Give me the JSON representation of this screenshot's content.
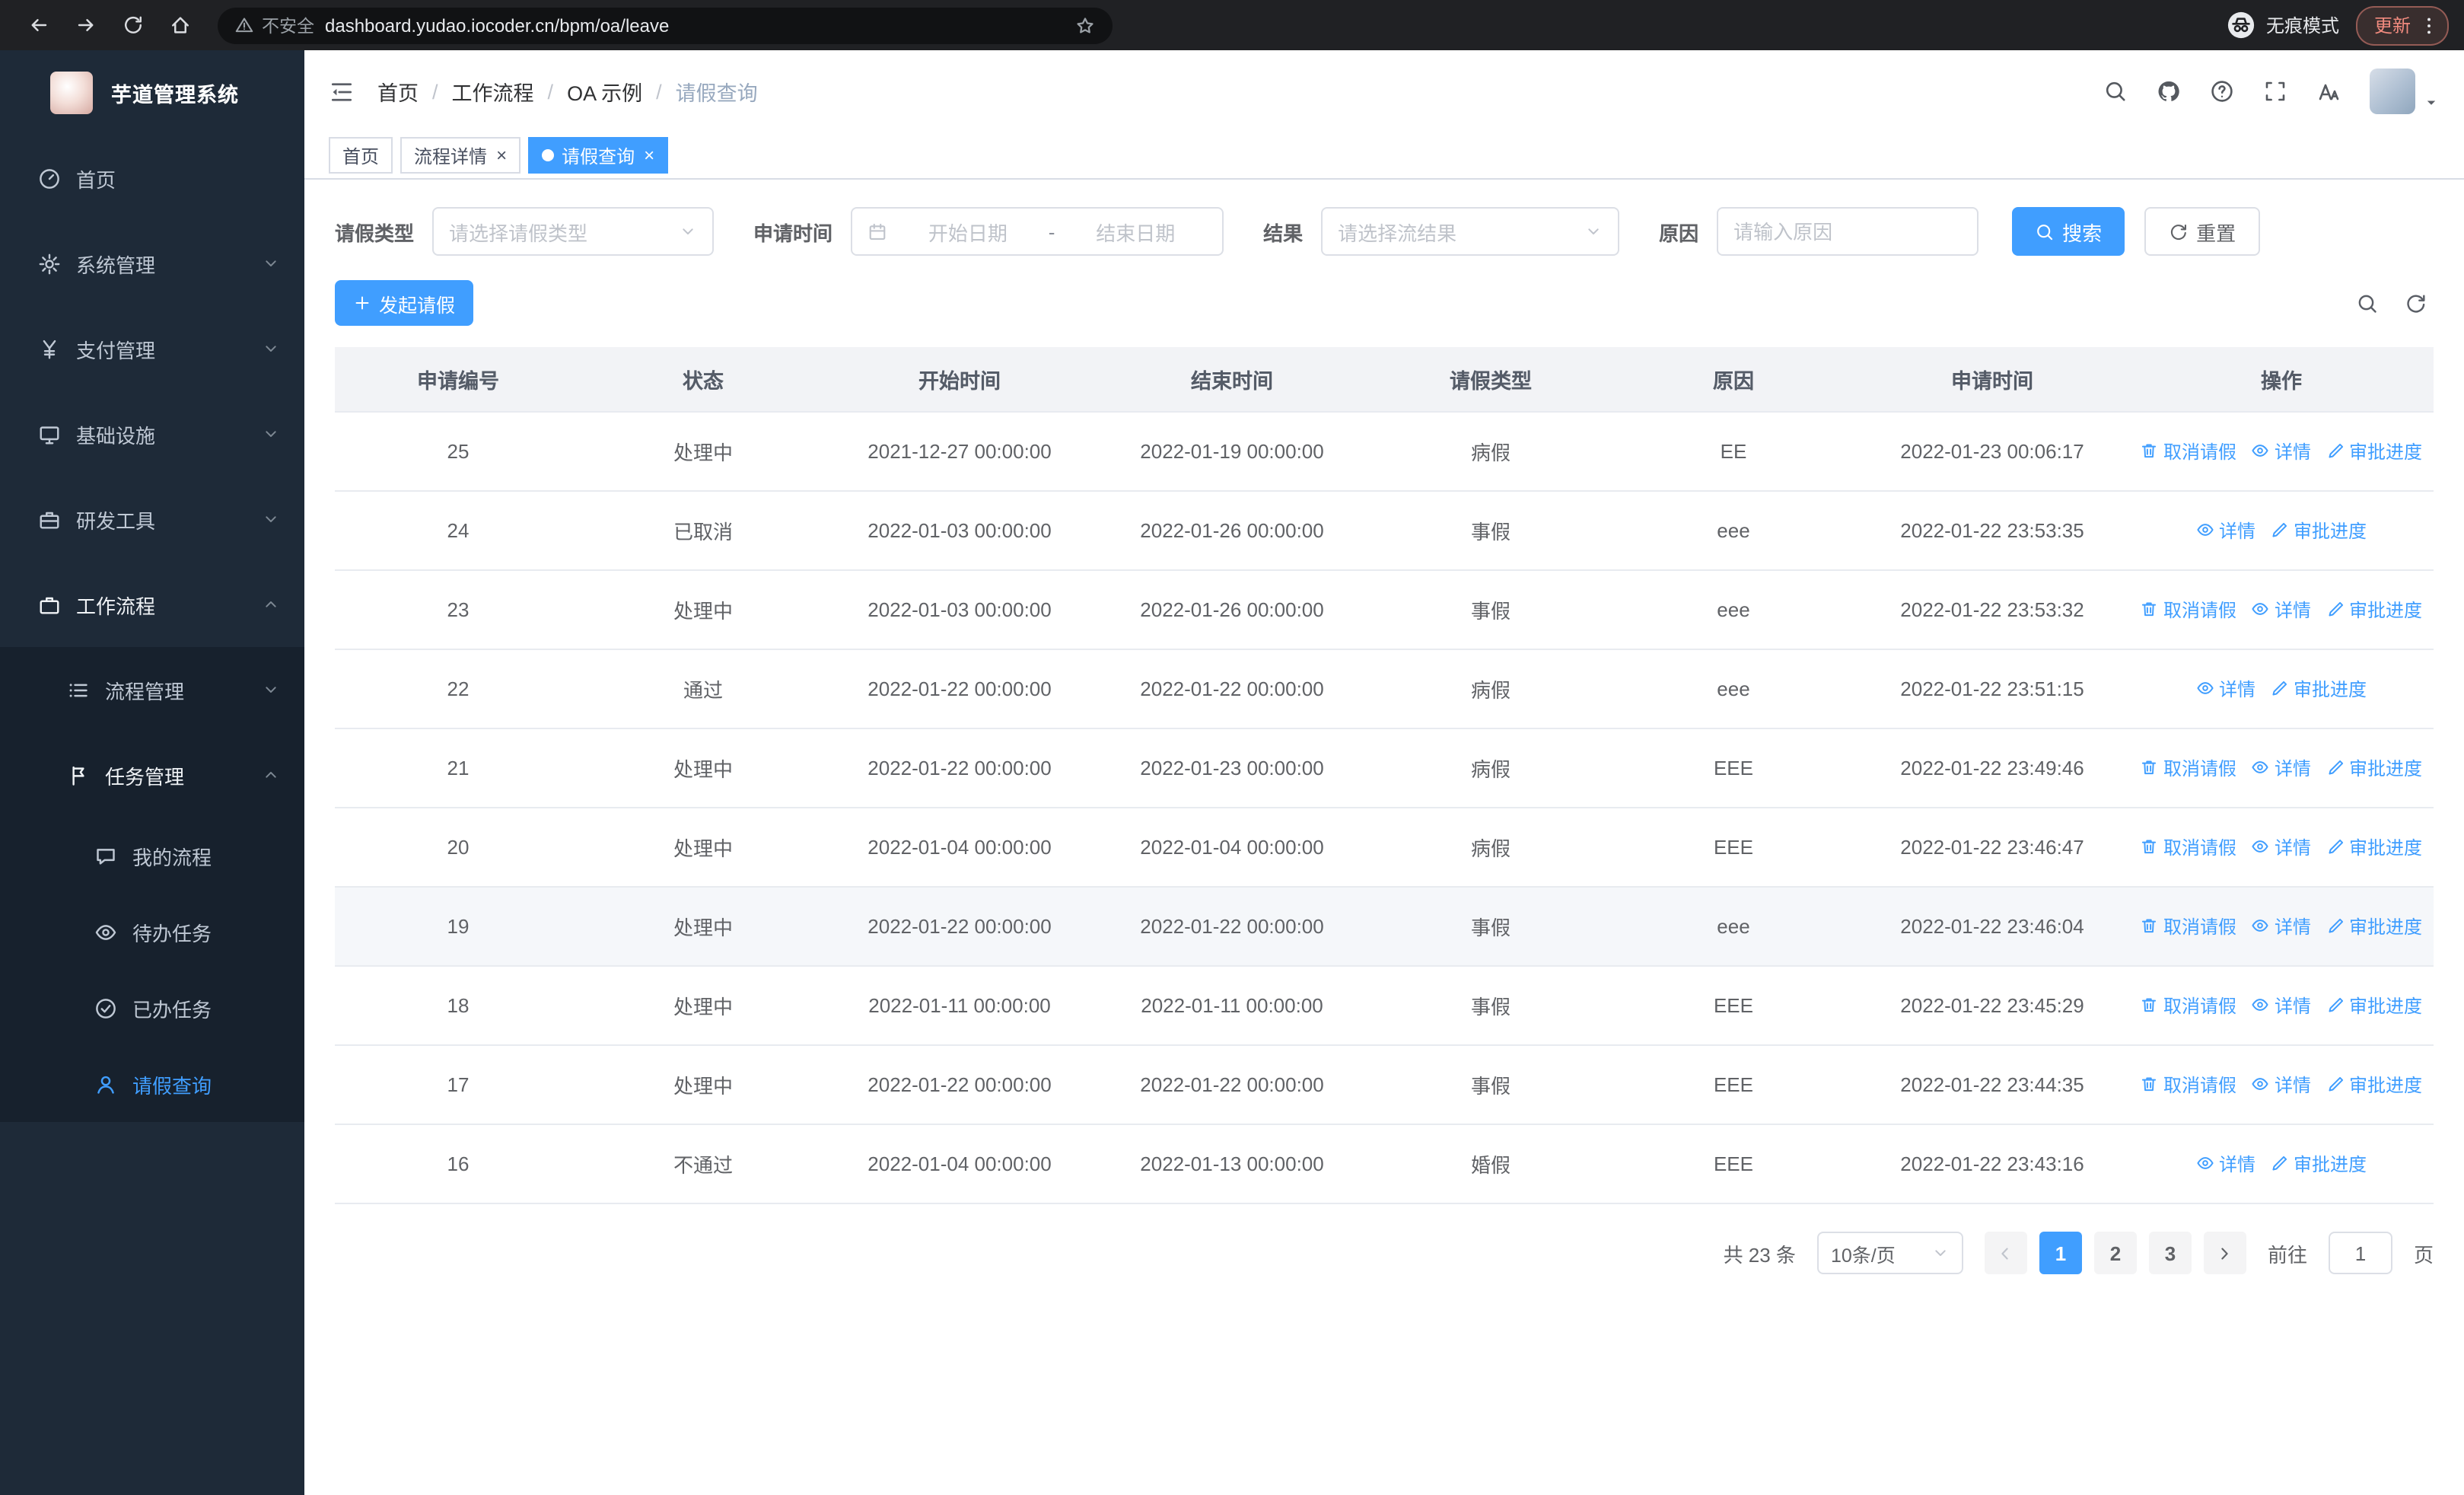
{
  "colors": {
    "primary": "#409eff",
    "sidebar_bg": "#1e2a38",
    "sidebar_sub_bg": "#17212d"
  },
  "browser": {
    "security_label": "不安全",
    "url": "dashboard.yudao.iocoder.cn/bpm/oa/leave",
    "incognito_label": "无痕模式",
    "update_label": "更新"
  },
  "sidebar": {
    "logo_title": "芋道管理系统",
    "items": [
      {
        "label": "首页",
        "icon": "dashboard-icon",
        "level": 1
      },
      {
        "label": "系统管理",
        "icon": "gear-icon",
        "level": 1,
        "chevron": "down"
      },
      {
        "label": "支付管理",
        "icon": "yen-icon",
        "level": 1,
        "chevron": "down"
      },
      {
        "label": "基础设施",
        "icon": "monitor-icon",
        "level": 1,
        "chevron": "down"
      },
      {
        "label": "研发工具",
        "icon": "toolbox-icon",
        "level": 1,
        "chevron": "down"
      },
      {
        "label": "工作流程",
        "icon": "workflow-icon",
        "level": 1,
        "chevron": "up",
        "expanded": true
      },
      {
        "label": "流程管理",
        "icon": "flow-icon",
        "level": 2,
        "chevron": "down",
        "sub": true
      },
      {
        "label": "任务管理",
        "icon": "task-icon",
        "level": 2,
        "chevron": "up",
        "sub": true,
        "expanded": true
      },
      {
        "label": "我的流程",
        "icon": "chat-icon",
        "level": 3,
        "sub": true
      },
      {
        "label": "待办任务",
        "icon": "eye-icon",
        "level": 3,
        "sub": true
      },
      {
        "label": "已办任务",
        "icon": "done-icon",
        "level": 3,
        "sub": true
      },
      {
        "label": "请假查询",
        "icon": "user-icon",
        "level": 3,
        "sub": true,
        "active": true
      }
    ]
  },
  "header": {
    "breadcrumb": [
      "首页",
      "工作流程",
      "OA 示例",
      "请假查询"
    ],
    "right_icons": [
      "search-icon",
      "github-icon",
      "question-icon",
      "fullscreen-icon",
      "font-size-icon"
    ]
  },
  "tabs": [
    {
      "label": "首页",
      "closable": false,
      "active": false
    },
    {
      "label": "流程详情",
      "closable": true,
      "active": false
    },
    {
      "label": "请假查询",
      "closable": true,
      "active": true
    }
  ],
  "filters": {
    "leave_type_label": "请假类型",
    "leave_type_placeholder": "请选择请假类型",
    "apply_time_label": "申请时间",
    "start_date_placeholder": "开始日期",
    "date_separator": "-",
    "end_date_placeholder": "结束日期",
    "result_label": "结果",
    "result_placeholder": "请选择流结果",
    "reason_label": "原因",
    "reason_placeholder": "请输入原因",
    "search_label": "搜索",
    "reset_label": "重置"
  },
  "toolbar": {
    "create_label": "发起请假",
    "right_icons": [
      "search-icon",
      "refresh-icon"
    ]
  },
  "table": {
    "columns": [
      "申请编号",
      "状态",
      "开始时间",
      "结束时间",
      "请假类型",
      "原因",
      "申请时间",
      "操作"
    ],
    "action_labels": {
      "cancel": "取消请假",
      "detail": "详情",
      "progress": "审批进度"
    },
    "rows": [
      {
        "id": "25",
        "status": "处理中",
        "start": "2021-12-27 00:00:00",
        "end": "2022-01-19 00:00:00",
        "type": "病假",
        "reason": "EE",
        "apply": "2022-01-23 00:06:17",
        "actions": [
          "cancel",
          "detail",
          "progress"
        ]
      },
      {
        "id": "24",
        "status": "已取消",
        "start": "2022-01-03 00:00:00",
        "end": "2022-01-26 00:00:00",
        "type": "事假",
        "reason": "eee",
        "apply": "2022-01-22 23:53:35",
        "actions": [
          "detail",
          "progress"
        ]
      },
      {
        "id": "23",
        "status": "处理中",
        "start": "2022-01-03 00:00:00",
        "end": "2022-01-26 00:00:00",
        "type": "事假",
        "reason": "eee",
        "apply": "2022-01-22 23:53:32",
        "actions": [
          "cancel",
          "detail",
          "progress"
        ]
      },
      {
        "id": "22",
        "status": "通过",
        "start": "2022-01-22 00:00:00",
        "end": "2022-01-22 00:00:00",
        "type": "病假",
        "reason": "eee",
        "apply": "2022-01-22 23:51:15",
        "actions": [
          "detail",
          "progress"
        ]
      },
      {
        "id": "21",
        "status": "处理中",
        "start": "2022-01-22 00:00:00",
        "end": "2022-01-23 00:00:00",
        "type": "病假",
        "reason": "EEE",
        "apply": "2022-01-22 23:49:46",
        "actions": [
          "cancel",
          "detail",
          "progress"
        ]
      },
      {
        "id": "20",
        "status": "处理中",
        "start": "2022-01-04 00:00:00",
        "end": "2022-01-04 00:00:00",
        "type": "病假",
        "reason": "EEE",
        "apply": "2022-01-22 23:46:47",
        "actions": [
          "cancel",
          "detail",
          "progress"
        ]
      },
      {
        "id": "19",
        "status": "处理中",
        "start": "2022-01-22 00:00:00",
        "end": "2022-01-22 00:00:00",
        "type": "事假",
        "reason": "eee",
        "apply": "2022-01-22 23:46:04",
        "actions": [
          "cancel",
          "detail",
          "progress"
        ],
        "hover": true
      },
      {
        "id": "18",
        "status": "处理中",
        "start": "2022-01-11 00:00:00",
        "end": "2022-01-11 00:00:00",
        "type": "事假",
        "reason": "EEE",
        "apply": "2022-01-22 23:45:29",
        "actions": [
          "cancel",
          "detail",
          "progress"
        ]
      },
      {
        "id": "17",
        "status": "处理中",
        "start": "2022-01-22 00:00:00",
        "end": "2022-01-22 00:00:00",
        "type": "事假",
        "reason": "EEE",
        "apply": "2022-01-22 23:44:35",
        "actions": [
          "cancel",
          "detail",
          "progress"
        ]
      },
      {
        "id": "16",
        "status": "不通过",
        "start": "2022-01-04 00:00:00",
        "end": "2022-01-13 00:00:00",
        "type": "婚假",
        "reason": "EEE",
        "apply": "2022-01-22 23:43:16",
        "actions": [
          "detail",
          "progress"
        ]
      }
    ]
  },
  "pagination": {
    "total_label": "共 23 条",
    "page_size": "10条/页",
    "pages": [
      "1",
      "2",
      "3"
    ],
    "active_page": "1",
    "goto_label": "前往",
    "goto_value": "1",
    "page_label": "页"
  }
}
